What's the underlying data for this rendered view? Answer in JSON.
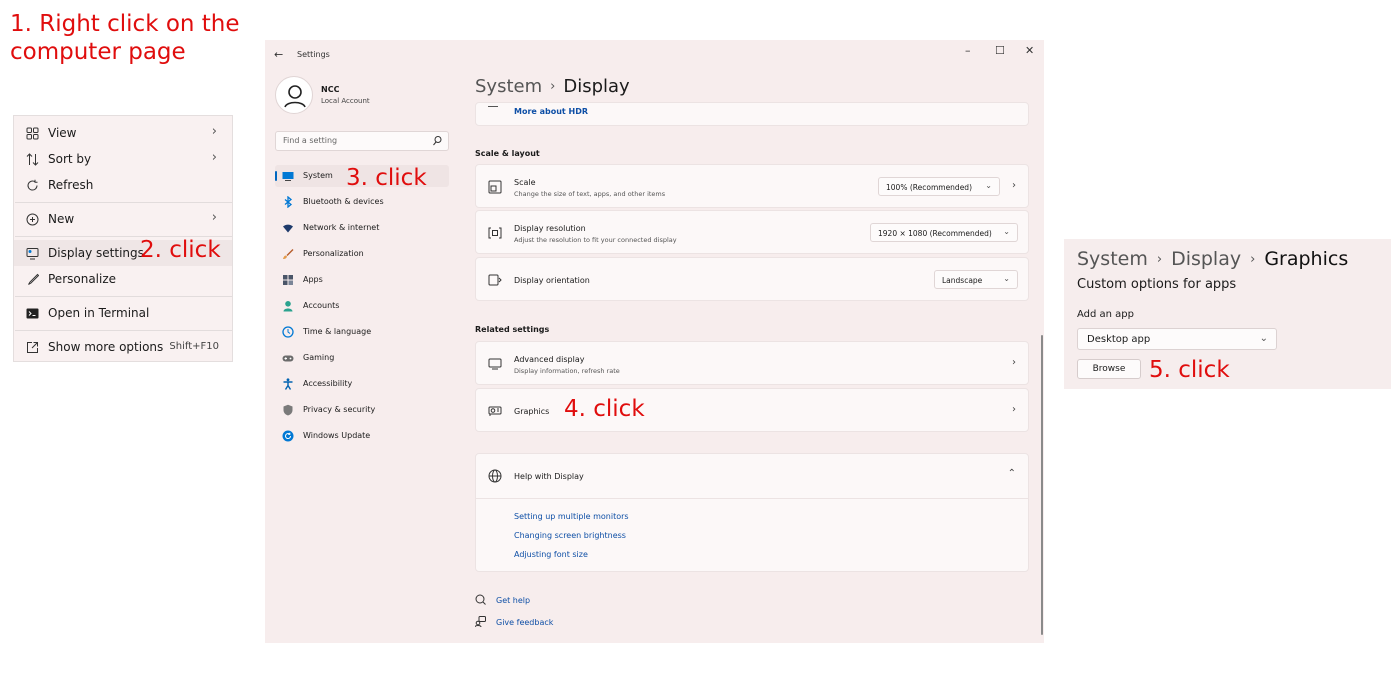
{
  "step1": {
    "line1": "1. Right click on the",
    "line2": "computer page"
  },
  "annotations": {
    "a2": "2. click",
    "a3": "3. click",
    "a4": "4. click",
    "a5": "5. click"
  },
  "context_menu": {
    "items": [
      {
        "label": "View",
        "icon": "grid-icon"
      },
      {
        "label": "Sort by",
        "icon": "sort-icon"
      },
      {
        "label": "Refresh",
        "icon": "refresh-icon"
      },
      {
        "label": "New",
        "icon": "plus-circle-icon"
      },
      {
        "label": "Display settings",
        "icon": "display-settings-icon"
      },
      {
        "label": "Personalize",
        "icon": "brush-icon"
      },
      {
        "label": "Open in Terminal",
        "icon": "terminal-icon"
      },
      {
        "label": "Show more options",
        "icon": "share-icon",
        "shortcut": "Shift+F10"
      }
    ]
  },
  "settings": {
    "title": "Settings",
    "window_controls": {
      "minimize": "–",
      "maximize": "☐",
      "close": "✕"
    },
    "user": {
      "name": "NCC",
      "sub": "Local Account"
    },
    "search_placeholder": "Find a setting",
    "nav": [
      {
        "label": "System",
        "icon": "monitor-icon",
        "color": "#0078d4"
      },
      {
        "label": "Bluetooth & devices",
        "icon": "bluetooth-icon",
        "color": "#0078d4"
      },
      {
        "label": "Network & internet",
        "icon": "wifi-icon",
        "color": "#1e3a6b"
      },
      {
        "label": "Personalization",
        "icon": "brush-icon",
        "color": "#b65d2c"
      },
      {
        "label": "Apps",
        "icon": "apps-icon",
        "color": "#4a5568"
      },
      {
        "label": "Accounts",
        "icon": "person-icon",
        "color": "#2ba38f"
      },
      {
        "label": "Time & language",
        "icon": "globe-clock-icon",
        "color": "#0078d4"
      },
      {
        "label": "Gaming",
        "icon": "gamepad-icon",
        "color": "#6b6b6b"
      },
      {
        "label": "Accessibility",
        "icon": "accessibility-icon",
        "color": "#0063b1"
      },
      {
        "label": "Privacy & security",
        "icon": "shield-icon",
        "color": "#7a7a7a"
      },
      {
        "label": "Windows Update",
        "icon": "update-icon",
        "color": "#0078d4"
      }
    ],
    "breadcrumb": {
      "parent": "System",
      "current": "Display"
    },
    "hdr_link": "More about HDR",
    "scale_section": "Scale & layout",
    "scale": {
      "title": "Scale",
      "sub": "Change the size of text, apps, and other items",
      "value": "100% (Recommended)"
    },
    "resolution": {
      "title": "Display resolution",
      "sub": "Adjust the resolution to fit your connected display",
      "value": "1920 × 1080 (Recommended)"
    },
    "orientation": {
      "title": "Display orientation",
      "value": "Landscape"
    },
    "related_section": "Related settings",
    "advanced": {
      "title": "Advanced display",
      "sub": "Display information, refresh rate"
    },
    "graphics": {
      "title": "Graphics"
    },
    "help": {
      "title": "Help with Display",
      "links": [
        "Setting up multiple monitors",
        "Changing screen brightness",
        "Adjusting font size"
      ]
    },
    "get_help": "Get help",
    "give_feedback": "Give feedback"
  },
  "graphics_panel": {
    "breadcrumb": [
      "System",
      "Display",
      "Graphics"
    ],
    "heading": "Custom options for apps",
    "add_label": "Add an app",
    "select_value": "Desktop app",
    "browse": "Browse"
  }
}
